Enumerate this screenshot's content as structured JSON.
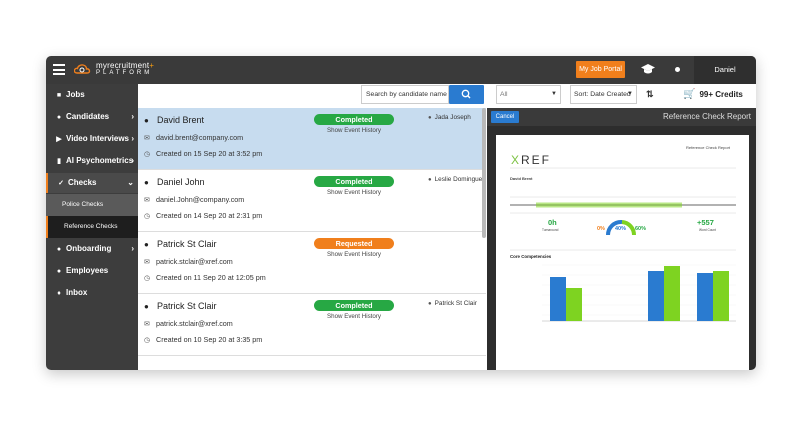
{
  "topbar": {
    "logo_line1_a": "my",
    "logo_line1_b": "recruitment",
    "logo_line1_c": "+",
    "logo_line2": "PLATFORM",
    "portal_label": "My Job Portal",
    "user_name": "Daniel"
  },
  "sidebar": {
    "items": [
      {
        "label": "Jobs",
        "icon": "briefcase-icon"
      },
      {
        "label": "Candidates",
        "icon": "users-icon"
      },
      {
        "label": "Video Interviews",
        "icon": "video-icon"
      },
      {
        "label": "AI Psychometrics",
        "icon": "chart-icon"
      },
      {
        "label": "Checks",
        "icon": "check-icon"
      },
      {
        "label": "Onboarding",
        "icon": "users-icon"
      },
      {
        "label": "Employees",
        "icon": "users-icon"
      },
      {
        "label": "Inbox",
        "icon": "bell-icon"
      }
    ],
    "sub_items": [
      "Police Checks",
      "Reference Checks"
    ]
  },
  "toolbar": {
    "search_placeholder": "Search by candidate name",
    "filter_value": "All",
    "sort_value": "Sort: Date Created",
    "credits": "99+ Credits"
  },
  "candidates": [
    {
      "name": "David Brent",
      "email": "david.brent@company.com",
      "created": "Created on 15 Sep 20 at 3:52 pm",
      "status": "Completed",
      "history": "Show Event History",
      "recruiter": "Jada Joseph"
    },
    {
      "name": "Daniel John",
      "email": "daniel.John@company.com",
      "created": "Created on 14 Sep 20 at 2:31 pm",
      "status": "Completed",
      "history": "Show Event History",
      "recruiter": "Leslie Domingue"
    },
    {
      "name": "Patrick St Clair",
      "email": "patrick.stclair@xref.com",
      "created": "Created on 11 Sep 20 at 12:05 pm",
      "status": "Requested",
      "history": "Show Event History",
      "recruiter": ""
    },
    {
      "name": "Patrick St Clair",
      "email": "patrick.stclair@xref.com",
      "created": "Created on 10 Sep 20 at 3:35 pm",
      "status": "Completed",
      "history": "Show Event History",
      "recruiter": "Patrick St Clair"
    }
  ],
  "report": {
    "cancel_label": "Cancel",
    "title": "Reference Check Report",
    "doc": {
      "logo_a": "X",
      "logo_b": "REF",
      "header_right": "Reference Check Report",
      "candidate": "David Brent",
      "turnaround": "0h",
      "turnaround_label": "Turnaround",
      "negative": "0%",
      "neutral": "40%",
      "positive": "60%",
      "word_count": "+557",
      "word_count_label": "Word Count",
      "core_title": "Core Competencies"
    },
    "chart_data": {
      "type": "bar",
      "title": "Core Competencies",
      "series": [
        {
          "name": "blue",
          "values": [
            68,
            0,
            0,
            84,
            70
          ]
        },
        {
          "name": "green",
          "values": [
            50,
            0,
            0,
            90,
            75
          ]
        }
      ],
      "ylim": [
        0,
        100
      ],
      "colors": {
        "blue": "#2a7bd0",
        "green": "#7ed321"
      }
    }
  },
  "colors": {
    "accent": "#f07f1c",
    "primary": "#2a7bd0",
    "completed": "#27a844",
    "requested": "#f07f1c"
  }
}
